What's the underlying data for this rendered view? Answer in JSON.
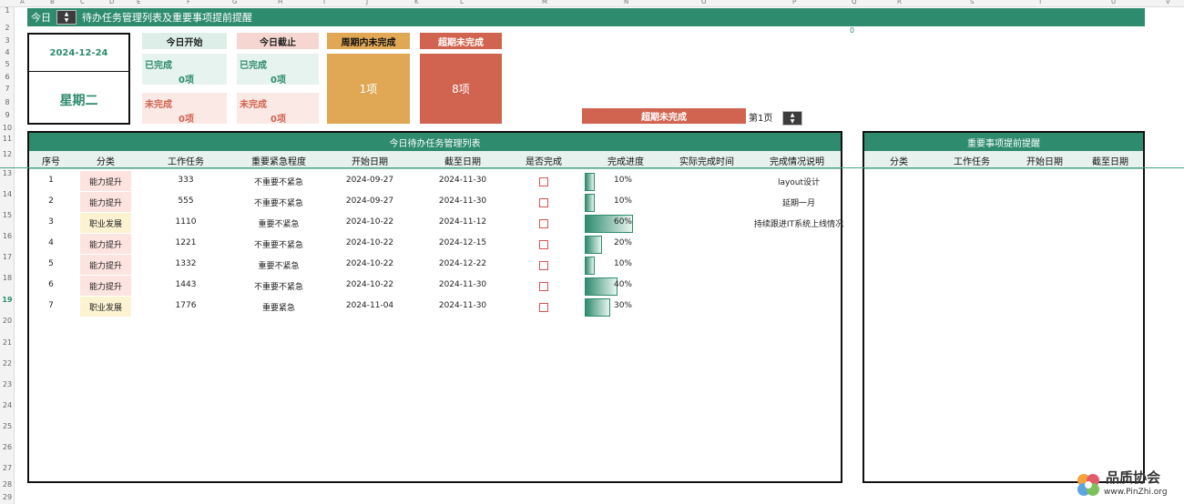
{
  "column_headers": [
    "A",
    "B",
    "C",
    "D",
    "E",
    "F",
    "G",
    "H",
    "I",
    "J",
    "K",
    "L",
    "M",
    "N",
    "O",
    "P",
    "Q",
    "R",
    "S",
    "T",
    "U",
    "V"
  ],
  "row_numbers": [
    "1",
    "2",
    "3",
    "4",
    "5",
    "6",
    "7",
    "8",
    "9",
    "10",
    "11",
    "12",
    "13",
    "14",
    "15",
    "16",
    "17",
    "18",
    "19",
    "20",
    "21",
    "22",
    "23",
    "24",
    "25",
    "26",
    "27",
    "28",
    "29"
  ],
  "active_row": "19",
  "banner": {
    "today_label": "今日",
    "title": "待办任务管理列表及重要事项提前提醒"
  },
  "date_panel": {
    "date": "2024-12-24",
    "weekday": "星期二"
  },
  "today_start": {
    "header": "今日开始",
    "done_label": "已完成",
    "done_count": "0项",
    "todo_label": "未完成",
    "todo_count": "0项"
  },
  "today_due": {
    "header": "今日截止",
    "done_label": "已完成",
    "done_count": "0项",
    "todo_label": "未完成",
    "todo_count": "0项"
  },
  "week_undone": {
    "header": "周期内未完成",
    "count": "1项"
  },
  "overdue": {
    "header": "超期未完成",
    "count": "8项"
  },
  "overdue_pager": {
    "label": "超期未完成",
    "page": "第1页",
    "stray_value": "0"
  },
  "task_panel": {
    "title": "今日待办任务管理列表",
    "columns": [
      "序号",
      "分类",
      "工作任务",
      "重要紧急程度",
      "开始日期",
      "截至日期",
      "是否完成",
      "完成进度",
      "实际完成时间",
      "完成情况说明"
    ],
    "rows": [
      {
        "no": "1",
        "category": "能力提升",
        "task": "333",
        "priority": "不重要不紧急",
        "start": "2024-09-27",
        "due": "2024-11-30",
        "progress": 0.1,
        "progress_text": "10%",
        "note": "layout设计"
      },
      {
        "no": "2",
        "category": "能力提升",
        "task": "555",
        "priority": "不重要不紧急",
        "start": "2024-09-27",
        "due": "2024-11-30",
        "progress": 0.1,
        "progress_text": "10%",
        "note": "延期一月"
      },
      {
        "no": "3",
        "category": "职业发展",
        "task": "1110",
        "priority": "重要不紧急",
        "start": "2024-10-22",
        "due": "2024-11-12",
        "progress": 0.6,
        "progress_text": "60%",
        "note": "持续跟进IT系统上线情况"
      },
      {
        "no": "4",
        "category": "能力提升",
        "task": "1221",
        "priority": "不重要不紧急",
        "start": "2024-10-22",
        "due": "2024-12-15",
        "progress": 0.2,
        "progress_text": "20%",
        "note": ""
      },
      {
        "no": "5",
        "category": "能力提升",
        "task": "1332",
        "priority": "重要不紧急",
        "start": "2024-10-22",
        "due": "2024-12-22",
        "progress": 0.1,
        "progress_text": "10%",
        "note": ""
      },
      {
        "no": "6",
        "category": "能力提升",
        "task": "1443",
        "priority": "不重要不紧急",
        "start": "2024-10-22",
        "due": "2024-11-30",
        "progress": 0.4,
        "progress_text": "40%",
        "note": ""
      },
      {
        "no": "7",
        "category": "职业发展",
        "task": "1776",
        "priority": "重要紧急",
        "start": "2024-11-04",
        "due": "2024-11-30",
        "progress": 0.3,
        "progress_text": "30%",
        "note": ""
      }
    ]
  },
  "reminder_panel": {
    "title": "重要事项提前提醒",
    "columns": [
      "分类",
      "工作任务",
      "开始日期",
      "截至日期"
    ]
  },
  "watermark": {
    "brand": "品质协会",
    "url": "www.PinZhi.org"
  },
  "colors": {
    "accent": "#2e8b6e",
    "orange": "#e0a855",
    "red": "#d16450",
    "pink_cat": "#fde4e0",
    "yellow_cat": "#fdf3d3"
  }
}
